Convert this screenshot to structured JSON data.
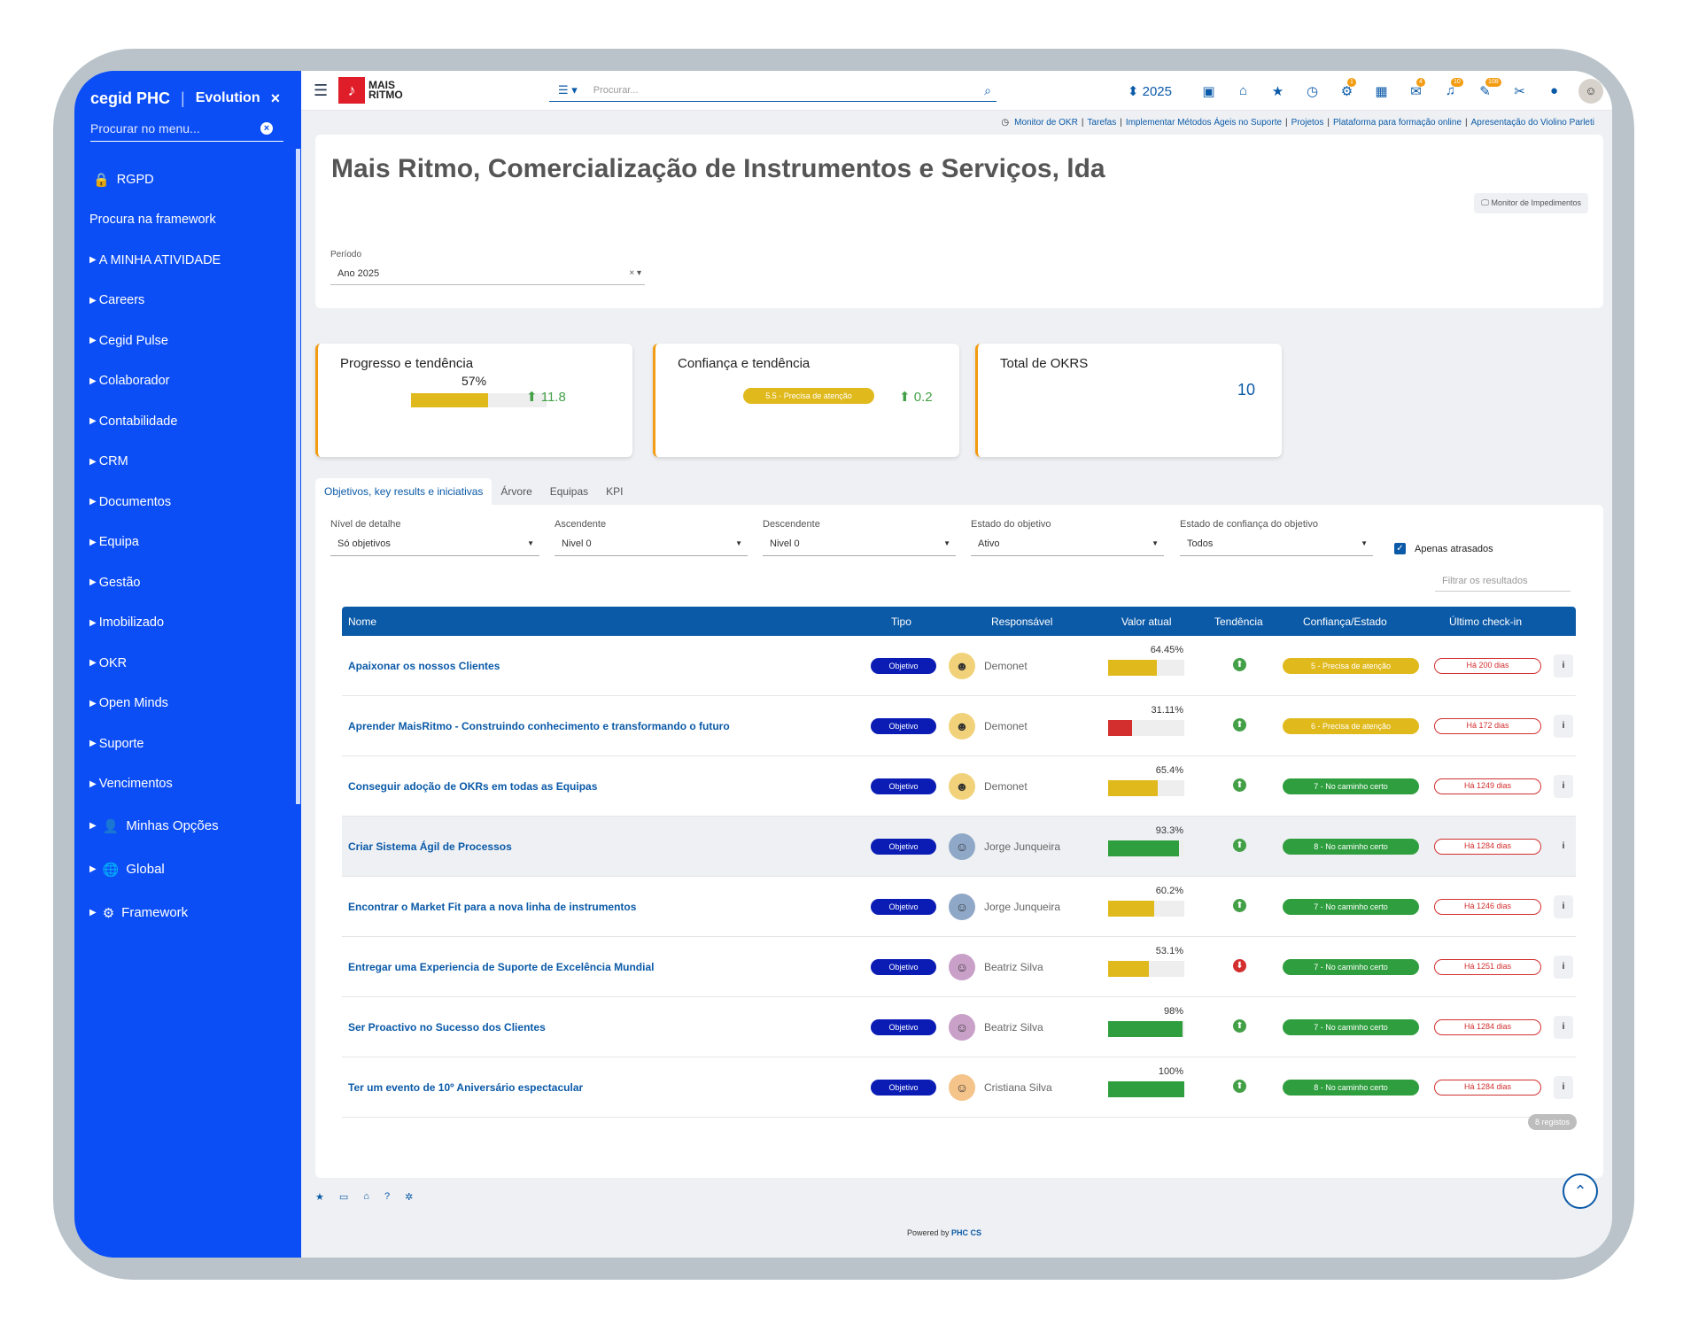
{
  "sidebar": {
    "brand": "cegid PHC",
    "edition": "Evolution",
    "close_icon": "×",
    "search_placeholder": "Procurar no menu...",
    "search_clear": "×",
    "items": [
      {
        "label": "RGPD",
        "icon": "lock-icon",
        "glyph": "🔒"
      },
      {
        "label": "Procura na framework"
      },
      {
        "label": "A MINHA ATIVIDADE"
      },
      {
        "label": "Careers"
      },
      {
        "label": "Cegid Pulse"
      },
      {
        "label": "Colaborador"
      },
      {
        "label": "Contabilidade"
      },
      {
        "label": "CRM"
      },
      {
        "label": "Documentos"
      },
      {
        "label": "Equipa"
      },
      {
        "label": "Gestão"
      },
      {
        "label": "Imobilizado"
      },
      {
        "label": "OKR"
      },
      {
        "label": "Open Minds"
      },
      {
        "label": "Suporte"
      },
      {
        "label": "Vencimentos"
      },
      {
        "label": "Minhas Opções",
        "icon": "user-icon",
        "glyph": "👤"
      },
      {
        "label": "Global",
        "icon": "globe-icon",
        "glyph": "🌐"
      },
      {
        "label": "Framework",
        "icon": "gears-icon",
        "glyph": "⚙"
      }
    ]
  },
  "topbar": {
    "menu_icon": "☰",
    "logo_mark": "♪",
    "logo_line1": "MAIS",
    "logo_line2": "RITMO",
    "search_menu_glyph": "☰ ▾",
    "search_placeholder": "Procurar...",
    "search_icon": "⌕",
    "year": "⬍ 2025",
    "icons": [
      {
        "name": "message-icon",
        "glyph": "▣"
      },
      {
        "name": "home-icon",
        "glyph": "⌂"
      },
      {
        "name": "star-icon",
        "glyph": "★"
      },
      {
        "name": "clock-icon",
        "glyph": "◷"
      },
      {
        "name": "cogs-icon",
        "glyph": "⚙",
        "badge": "1"
      },
      {
        "name": "calendar-icon",
        "glyph": "▦"
      },
      {
        "name": "mail-icon",
        "glyph": "✉",
        "badge": "4"
      },
      {
        "name": "bell-icon",
        "glyph": "♫",
        "badge": "10"
      },
      {
        "name": "chat-icon",
        "glyph": "✎",
        "badge": "108"
      },
      {
        "name": "wrench-icon",
        "glyph": "✂"
      },
      {
        "name": "bulb-icon",
        "glyph": "●"
      }
    ],
    "avatar_glyph": "☺"
  },
  "breadcrumbs": {
    "clock": "◷",
    "items": [
      "Monitor de OKR",
      "Tarefas",
      "Implementar Métodos Ágeis no Suporte",
      "Projetos",
      "Plataforma para formação online",
      "Apresentação do Violino Parleti"
    ],
    "sep": "|"
  },
  "header": {
    "title": "Mais Ritmo, Comercialização de Instrumentos e Serviços, lda",
    "impedimentos_btn": "🖵 Monitor de Impedimentos",
    "periodo_label": "Período",
    "periodo_value": "Ano 2025",
    "periodo_ctl": "× ▾"
  },
  "kpis": {
    "progress": {
      "title": "Progresso e tendência",
      "percent_label": "57%",
      "percent": 57,
      "trend": "⬆ 11.8",
      "color": "#e0b91c"
    },
    "confidence": {
      "title": "Confiança e tendência",
      "pill": "5.5 - Precisa de atenção",
      "trend": "⬆ 0.2"
    },
    "total": {
      "title": "Total de OKRS",
      "value": "10"
    }
  },
  "tabs": [
    "Objetivos, key results e iniciativas",
    "Árvore",
    "Equipas",
    "KPI"
  ],
  "filters": {
    "detalhe": {
      "label": "Nível de detalhe",
      "value": "Só objetivos"
    },
    "ascendente": {
      "label": "Ascendente",
      "value": "Nivel 0"
    },
    "descendente": {
      "label": "Descendente",
      "value": "Nivel 0"
    },
    "estado": {
      "label": "Estado do objetivo",
      "value": "Ativo"
    },
    "confianca": {
      "label": "Estado de confiança do objetivo",
      "value": "Todos"
    },
    "dropdown_glyph": "▼",
    "apenas_atrasados": "Apenas atrasados",
    "checked_glyph": "✓",
    "filtrar_placeholder": "Filtrar os resultados"
  },
  "table": {
    "headers": {
      "nome": "Nome",
      "tipo": "Tipo",
      "responsavel": "Responsável",
      "valor": "Valor atual",
      "tendencia": "Tendência",
      "confianca": "Confiança/Estado",
      "checkin": "Último check-in"
    },
    "info_glyph": "i",
    "rows": [
      {
        "nome": "Apaixonar os nossos Clientes",
        "tipo": "Objetivo",
        "avatar": "☻",
        "avatar_bg": "#f1d27a",
        "resp": "Demonet",
        "valor": "64.45%",
        "pct": 64.45,
        "bar_color": "#e0b91c",
        "trend": "⬆",
        "trend_color": "#43a047",
        "conf": "5 - Precisa de atenção",
        "conf_color": "#e0b91c",
        "checkin": "Há 200 dias"
      },
      {
        "nome": "Aprender MaisRitmo - Construindo conhecimento e transformando o futuro",
        "tipo": "Objetivo",
        "avatar": "☻",
        "avatar_bg": "#f1d27a",
        "resp": "Demonet",
        "valor": "31.11%",
        "pct": 31.11,
        "bar_color": "#d32f2f",
        "trend": "⬆",
        "trend_color": "#43a047",
        "conf": "6 - Precisa de atenção",
        "conf_color": "#e0b91c",
        "checkin": "Há 172 dias"
      },
      {
        "nome": "Conseguir adoção de OKRs em todas as Equipas",
        "tipo": "Objetivo",
        "avatar": "☻",
        "avatar_bg": "#f1d27a",
        "resp": "Demonet",
        "valor": "65.4%",
        "pct": 65.4,
        "bar_color": "#e0b91c",
        "trend": "⬆",
        "trend_color": "#43a047",
        "conf": "7 - No caminho certo",
        "conf_color": "#2e9e3e",
        "checkin": "Há 1249 dias"
      },
      {
        "nome": "Criar Sistema Ágil de Processos",
        "tipo": "Objetivo",
        "avatar": "☺",
        "avatar_bg": "#8fa8c8",
        "resp": "Jorge Junqueira",
        "valor": "93.3%",
        "pct": 93.3,
        "bar_color": "#2e9e3e",
        "trend": "⬆",
        "trend_color": "#43a047",
        "conf": "8 - No caminho certo",
        "conf_color": "#2e9e3e",
        "checkin": "Há 1284 dias"
      },
      {
        "nome": "Encontrar o Market Fit para a nova linha de instrumentos",
        "tipo": "Objetivo",
        "avatar": "☺",
        "avatar_bg": "#8fa8c8",
        "resp": "Jorge Junqueira",
        "valor": "60.2%",
        "pct": 60.2,
        "bar_color": "#e0b91c",
        "trend": "⬆",
        "trend_color": "#43a047",
        "conf": "7 - No caminho certo",
        "conf_color": "#2e9e3e",
        "checkin": "Há 1246 dias"
      },
      {
        "nome": "Entregar uma Experiencia de Suporte de Excelência Mundial",
        "tipo": "Objetivo",
        "avatar": "☺",
        "avatar_bg": "#c9a0c8",
        "resp": "Beatriz Silva",
        "valor": "53.1%",
        "pct": 53.1,
        "bar_color": "#e0b91c",
        "trend": "⬇",
        "trend_color": "#d32f2f",
        "conf": "7 - No caminho certo",
        "conf_color": "#2e9e3e",
        "checkin": "Há 1251 dias"
      },
      {
        "nome": "Ser Proactivo no Sucesso dos Clientes",
        "tipo": "Objetivo",
        "avatar": "☺",
        "avatar_bg": "#c9a0c8",
        "resp": "Beatriz Silva",
        "valor": "98%",
        "pct": 98,
        "bar_color": "#2e9e3e",
        "trend": "⬆",
        "trend_color": "#43a047",
        "conf": "7 - No caminho certo",
        "conf_color": "#2e9e3e",
        "checkin": "Há 1284 dias"
      },
      {
        "nome": "Ter um evento de 10º Aniversário espectacular",
        "tipo": "Objetivo",
        "avatar": "☺",
        "avatar_bg": "#f4c48a",
        "resp": "Cristiana Silva",
        "valor": "100%",
        "pct": 100,
        "bar_color": "#2e9e3e",
        "trend": "⬆",
        "trend_color": "#43a047",
        "conf": "8 - No caminho certo",
        "conf_color": "#2e9e3e",
        "checkin": "Há 1284 dias"
      }
    ],
    "registos": "8 registos"
  },
  "footer": {
    "icons": [
      {
        "name": "star-icon",
        "glyph": "★"
      },
      {
        "name": "monitor-icon",
        "glyph": "▭"
      },
      {
        "name": "home-gear-icon",
        "glyph": "⌂"
      },
      {
        "name": "help-icon",
        "glyph": "?"
      },
      {
        "name": "settings-icon",
        "glyph": "✲"
      }
    ],
    "powered_prefix": "Powered by ",
    "powered_brand": "PHC CS",
    "scrollup_glyph": "⌃"
  }
}
